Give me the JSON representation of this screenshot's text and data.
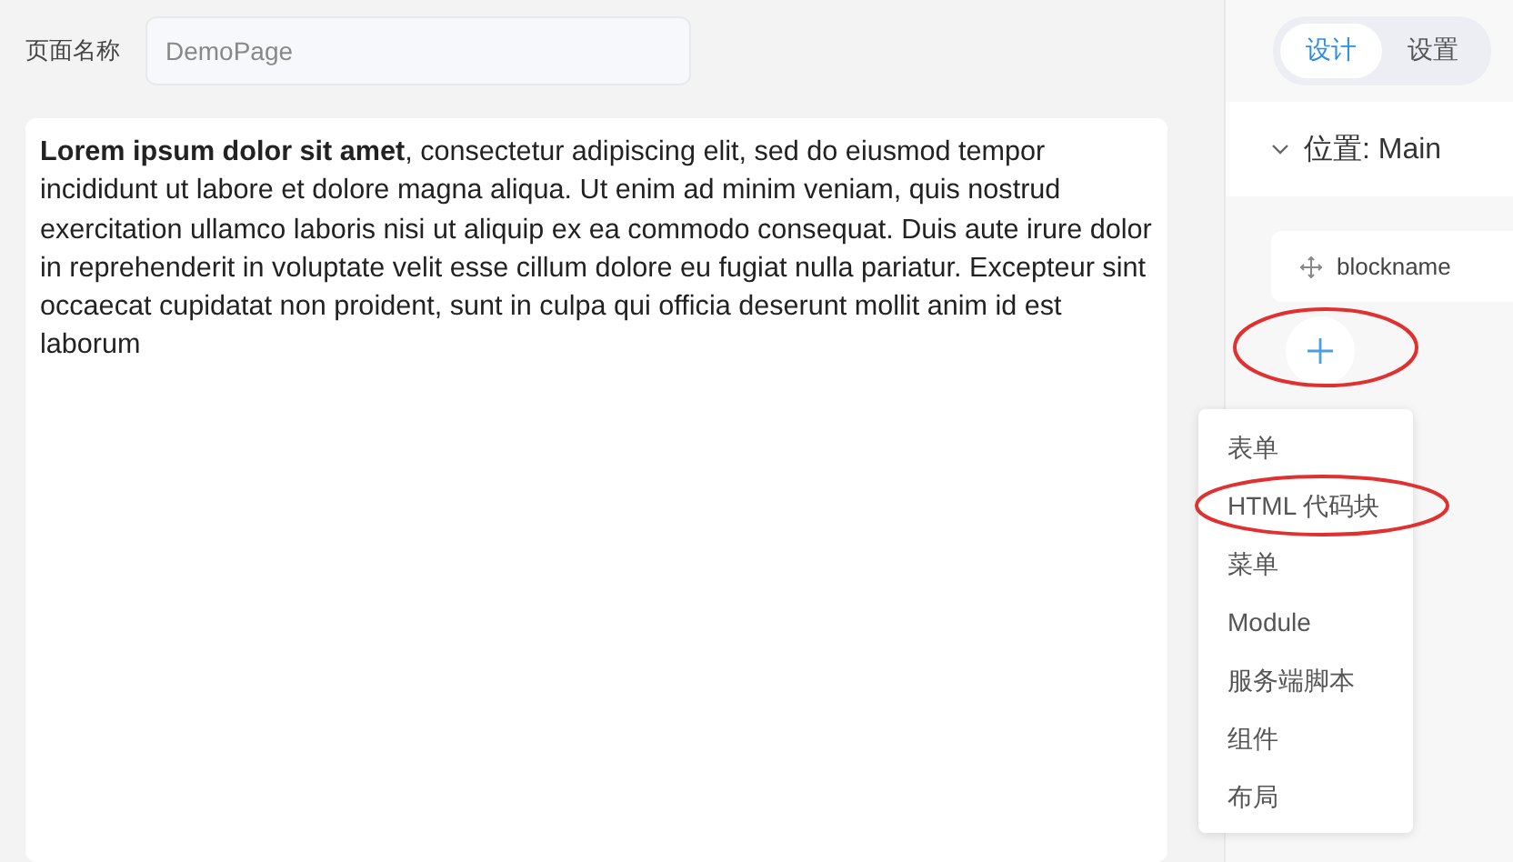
{
  "page_name": {
    "label": "页面名称",
    "value": "DemoPage"
  },
  "content": "**Lorem ipsum dolor sit amet**, consectetur adipiscing elit, sed do eiusmod tempor incididunt ut labore et dolore magna aliqua. Ut enim ad minim veniam, quis nostrud exercitation ullamco laboris nisi ut aliquip ex ea commodo consequat. Duis aute irure dolor in reprehenderit in voluptate velit esse cillum dolore eu fugiat nulla pariatur. Excepteur sint occaecat cupidatat non proident, sunt in culpa qui officia deserunt mollit anim id est laborum",
  "tabs": [
    {
      "label": "设计",
      "selected": true
    },
    {
      "label": "设置",
      "selected": false
    }
  ],
  "section": {
    "title": "位置: Main",
    "expanded": true
  },
  "block": {
    "name": "blockname"
  },
  "add_menu": [
    "表单",
    "HTML 代码块",
    "菜单",
    "Module",
    "服务端脚本",
    "组件",
    "布局"
  ]
}
